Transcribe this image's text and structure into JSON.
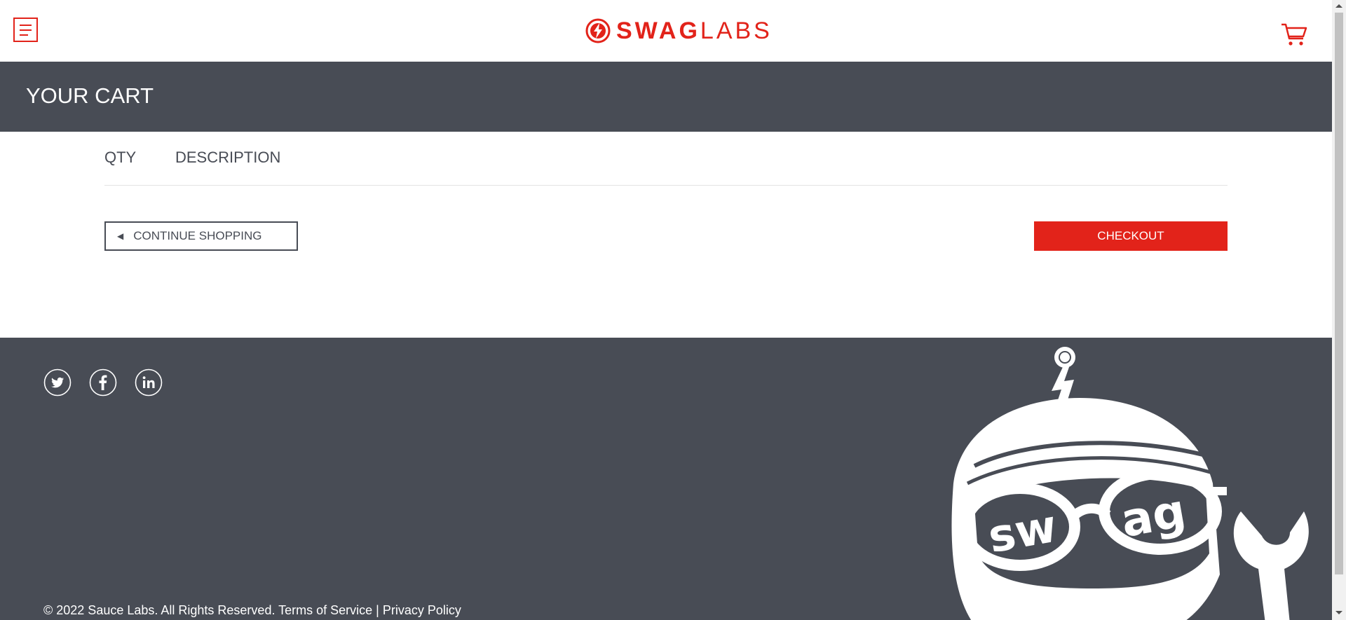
{
  "header": {
    "logo": {
      "bold": "SWAG",
      "light": "LABS"
    },
    "menu_icon": "hamburger-menu-icon",
    "cart_icon": "shopping-cart-icon"
  },
  "page": {
    "title": "YOUR CART"
  },
  "cart": {
    "columns": [
      "QTY",
      "DESCRIPTION"
    ],
    "items": []
  },
  "buttons": {
    "continue_label": "CONTINUE SHOPPING",
    "checkout_label": "CHECKOUT"
  },
  "footer": {
    "social": [
      "twitter-icon",
      "facebook-icon",
      "linkedin-icon"
    ],
    "copyright": "© 2022 Sauce Labs. All Rights Reserved. Terms of Service | Privacy Policy"
  },
  "colors": {
    "brand_red": "#e2231a",
    "dark_slate": "#484c55",
    "white": "#ffffff"
  }
}
